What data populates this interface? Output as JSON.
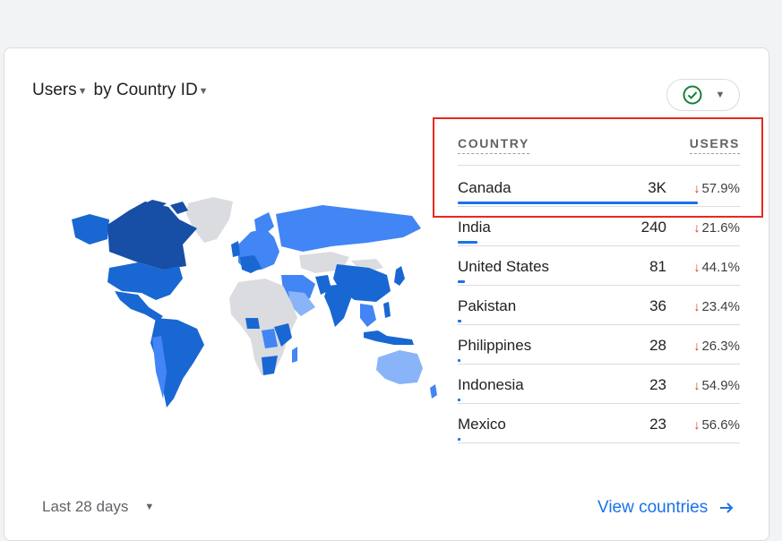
{
  "card": {
    "metric_label": "Users",
    "by_label": "by Country ID",
    "status_icon": "check-circle-icon"
  },
  "table": {
    "headers": {
      "country": "COUNTRY",
      "users": "USERS"
    },
    "rows": [
      {
        "country": "Canada",
        "value": "3K",
        "change": "57.9%",
        "share": 0.85
      },
      {
        "country": "India",
        "value": "240",
        "change": "21.6%",
        "share": 0.07
      },
      {
        "country": "United States",
        "value": "81",
        "change": "44.1%",
        "share": 0.025
      },
      {
        "country": "Pakistan",
        "value": "36",
        "change": "23.4%",
        "share": 0.012
      },
      {
        "country": "Philippines",
        "value": "28",
        "change": "26.3%",
        "share": 0.009
      },
      {
        "country": "Indonesia",
        "value": "23",
        "change": "54.9%",
        "share": 0.008
      },
      {
        "country": "Mexico",
        "value": "23",
        "change": "56.6%",
        "share": 0.008
      }
    ]
  },
  "footer": {
    "date_range": "Last 28 days",
    "link_label": "View countries"
  },
  "colors": {
    "accent": "#1a73e8",
    "decline": "#d93025",
    "map_darkest": "#174ea6",
    "map_dark": "#1967d2",
    "map_mid": "#4285f4",
    "map_light": "#8ab4f8",
    "map_none": "#dadce0",
    "highlight_box": "#e8291f"
  }
}
